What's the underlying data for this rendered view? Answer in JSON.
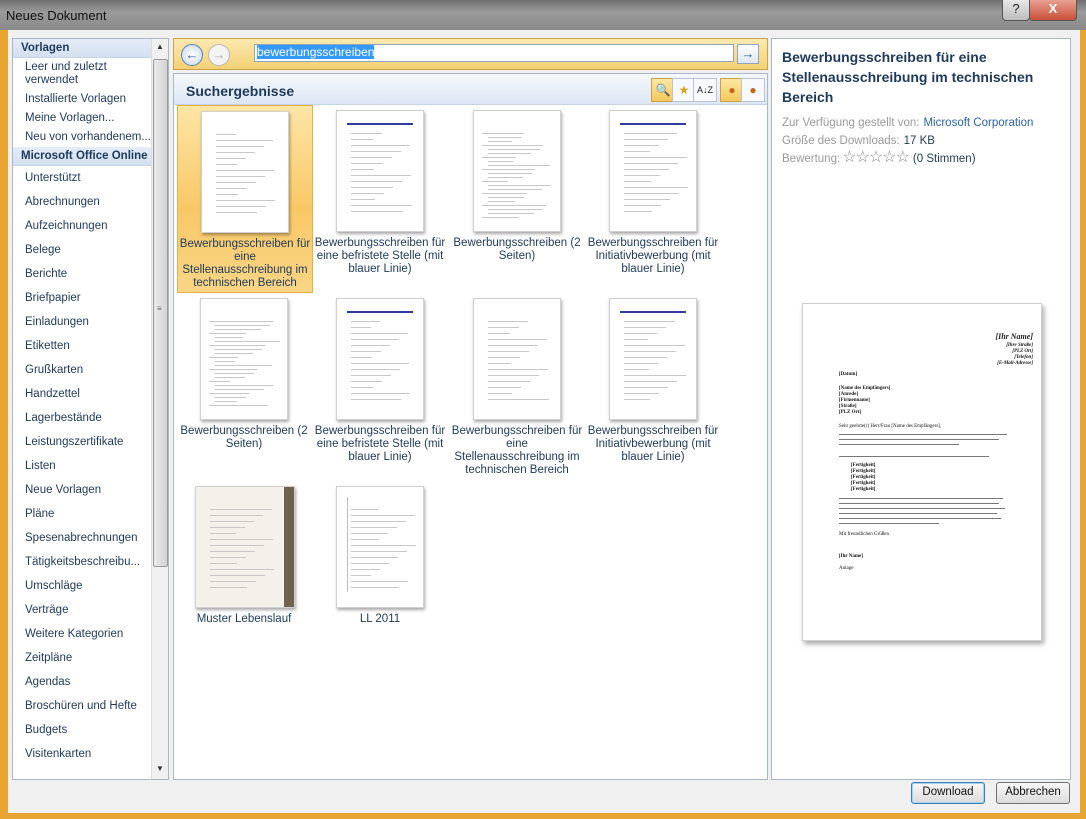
{
  "window": {
    "title": "Neues Dokument",
    "help_label": "?",
    "close_label": "X"
  },
  "left": {
    "header_templates": "Vorlagen",
    "header_online": "Microsoft Office Online",
    "local_items": [
      "Leer und zuletzt verwendet",
      "Installierte Vorlagen",
      "Meine Vorlagen...",
      "Neu von vorhandenem..."
    ],
    "online_items": [
      "Unterstützt",
      "Abrechnungen",
      "Aufzeichnungen",
      "Belege",
      "Berichte",
      "Briefpapier",
      "Einladungen",
      "Etiketten",
      "Grußkarten",
      "Handzettel",
      "Lagerbestände",
      "Leistungszertifikate",
      "Listen",
      "Neue Vorlagen",
      "Pläne",
      "Spesenabrechnungen",
      "Tätigkeitsbeschreibu...",
      "Umschläge",
      "Verträge",
      "Weitere Kategorien",
      "Zeitpläne",
      "Agendas",
      "Broschüren und Hefte",
      "Budgets",
      "Visitenkarten"
    ],
    "scroll_up": "▲",
    "scroll_down": "▼"
  },
  "search": {
    "query": "bewerbungsschreiben",
    "back_icon": "arrow-left-icon",
    "forward_icon": "arrow-right-icon",
    "go_icon": "go-arrow-icon"
  },
  "results": {
    "title": "Suchergebnisse",
    "toolbar_icons": [
      "zoom-icon",
      "star-sort-icon",
      "az-sort-icon",
      "person-icon",
      "person-remove-icon"
    ],
    "sort_az_label": "A↓Z",
    "items": [
      {
        "label": "Bewerbungsschreiben für eine Stellenausschreibung im technischen Bereich",
        "selected": true
      },
      {
        "label": "Bewerbungsschreiben für eine befristete Stelle (mit blauer Linie)",
        "selected": false
      },
      {
        "label": "Bewerbungsschreiben (2 Seiten)",
        "selected": false
      },
      {
        "label": "Bewerbungsschreiben für Initiativbewerbung (mit blauer Linie)",
        "selected": false
      },
      {
        "label": "Bewerbungsschreiben (2 Seiten)",
        "selected": false
      },
      {
        "label": "Bewerbungsschreiben für eine befristete Stelle (mit blauer Linie)",
        "selected": false
      },
      {
        "label": "Bewerbungsschreiben für eine Stellenausschreibung im technischen Bereich",
        "selected": false
      },
      {
        "label": "Bewerbungsschreiben für Initiativbewerbung (mit blauer Linie)",
        "selected": false
      },
      {
        "label": "Muster Lebenslauf",
        "selected": false
      },
      {
        "label": "LL 2011",
        "selected": false
      }
    ]
  },
  "preview": {
    "title": "Bewerbungsschreiben für eine Stellenausschreibung im technischen Bereich",
    "provider_label": "Zur Verfügung gestellt von:",
    "provider": "Microsoft Corporation",
    "size_label": "Größe des Downloads:",
    "size": "17 KB",
    "rating_label": "Bewertung:",
    "rating_stars": "☆☆☆☆☆",
    "rating_votes": "(0 Stimmen)",
    "doc": {
      "name": "[Ihr Name]",
      "sender": [
        "[Ihre Straße]",
        "[PLZ Ort]",
        "[Telefon]",
        "[E-Mail-Adresse]"
      ],
      "date": "[Datum]",
      "recipient": [
        "[Name des Empfängers]",
        "[Anrede]",
        "[Firmenname]",
        "[Straße]",
        "[PLZ Ort]"
      ],
      "salutation": "Sehr geehrte(r) Herr/Frau [Name des Empfängers],",
      "skills": [
        "[Fertigkeit]",
        "[Fertigkeit]",
        "[Fertigkeit]",
        "[Fertigkeit]",
        "[Fertigkeit]"
      ],
      "closing": "Mit freundlichen Grüßen",
      "sign": "[Ihr Name]",
      "attachment": "Anlage"
    }
  },
  "buttons": {
    "download": "Download",
    "cancel": "Abbrechen"
  }
}
